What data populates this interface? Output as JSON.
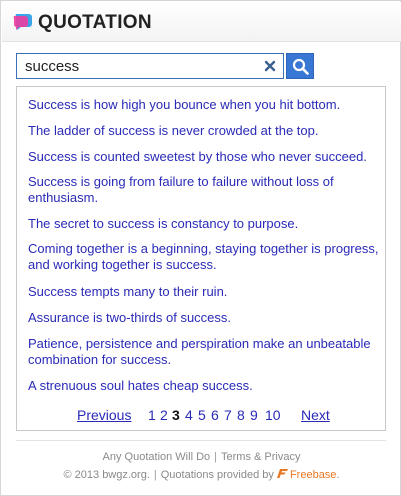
{
  "header": {
    "title": "QUOTATION",
    "logo_icon": "speech-bubble-icon"
  },
  "search": {
    "value": "success",
    "placeholder": ""
  },
  "colors": {
    "link": "#2a2ab8",
    "accent": "#3878d4",
    "freebase": "#e87722"
  },
  "quotes": [
    "Success is how high you bounce when you hit bottom.",
    "The ladder of success is never crowded at the top.",
    "Success is counted sweetest by those who never succeed.",
    "Success is going from failure to failure without loss of enthusiasm.",
    "The secret to success is constancy to purpose.",
    "Coming together is a beginning, staying together is progress, and working together is success.",
    "Success tempts many to their ruin.",
    "Assurance is two-thirds of success.",
    "Patience, persistence and perspiration make an unbeatable combination for success.",
    "A strenuous soul hates cheap success."
  ],
  "pager": {
    "previous": "Previous",
    "next": "Next",
    "pages": [
      "1",
      "2",
      "3",
      "4",
      "5",
      "6",
      "7",
      "8",
      "9",
      "10"
    ],
    "current": "3"
  },
  "footer": {
    "line1_a": "Any Quotation Will Do",
    "line1_b": "Terms & Privacy",
    "line2_a": "© 2013 bwgz.org.",
    "line2_b": "Quotations provided by",
    "line2_brand": "Freebase",
    "line2_end": "."
  }
}
